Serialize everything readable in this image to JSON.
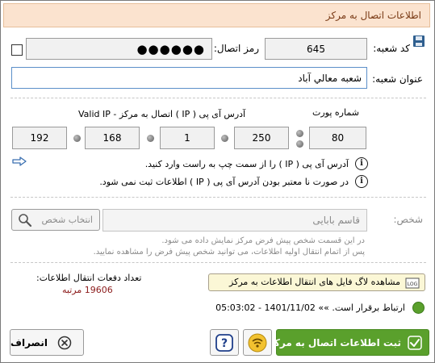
{
  "window": {
    "title": "اطلاعات اتصال به مرکز"
  },
  "branch": {
    "code_label": "کد شعبه:",
    "code_value": "645",
    "password_label": "رمز اتصال:",
    "password_value": "●●●●●●",
    "title_label": "عنوان شعبه:",
    "title_value": "شعبه معالي آباد"
  },
  "server": {
    "ip_label": "آدرس آی پی ( IP ) اتصال به مرکز - Valid IP",
    "port_label": "شماره پورت",
    "ip_octets": [
      "192",
      "168",
      "1",
      "250"
    ],
    "port_value": "80",
    "note1": "آدرس آی پی ( IP ) را از سمت چپ به راست وارد کنید.",
    "note2": "در صورت نا معتبر بودن آدرس آی پی ( IP ) اطلاعات ثبت نمی شود."
  },
  "person": {
    "label": "شخص:",
    "value": "قاسم بابایی",
    "select_button": "انتخاب شخص",
    "help1": "در این قسمت شخص پیش فرض مرکز نمایش داده می شود.",
    "help2": "پس از اتمام انتقال اولیه اطلاعات، می توانید شخص پیش فرض را مشاهده نمایید."
  },
  "transfer": {
    "count_label": "تعداد دفعات انتقال اطلاعات:",
    "count_value": "19606 مرتبه",
    "log_button": "مشاهده لاگ فایل های انتقال اطلاعات به مرکز"
  },
  "status": {
    "text": "ارتباط برقرار است. »» 1401/11/02 - 05:03:02",
    "color": "#5aa02c"
  },
  "buttons": {
    "save": "ثبت اطلاعات اتصال به مرکز",
    "cancel": "انصراف"
  },
  "colors": {
    "title_bg": "#fbe3cf",
    "save_bg": "#5aa02c",
    "count_value": "#8b1a1a"
  }
}
